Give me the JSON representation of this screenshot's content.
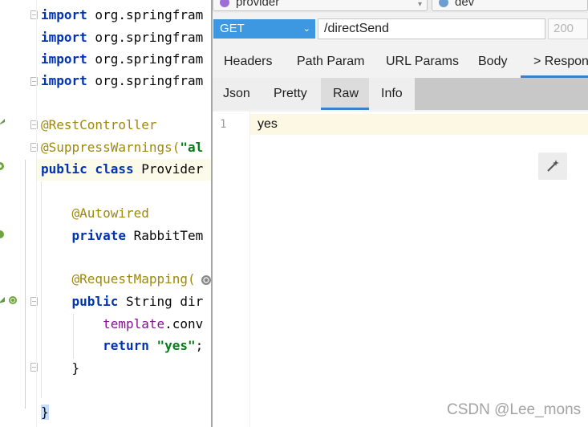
{
  "editor": {
    "lines": [
      {
        "parts": [
          {
            "t": "import",
            "c": "kw"
          },
          {
            "t": " org.springfram",
            "c": ""
          }
        ]
      },
      {
        "parts": [
          {
            "t": "import",
            "c": "kw"
          },
          {
            "t": " org.springfram",
            "c": ""
          }
        ]
      },
      {
        "parts": [
          {
            "t": "import",
            "c": "kw"
          },
          {
            "t": " org.springfram",
            "c": ""
          }
        ]
      },
      {
        "parts": [
          {
            "t": "import",
            "c": "kw"
          },
          {
            "t": " org.springfram",
            "c": ""
          }
        ]
      },
      {
        "parts": []
      },
      {
        "parts": [
          {
            "t": "@RestController",
            "c": "ann"
          }
        ]
      },
      {
        "parts": [
          {
            "t": "@SuppressWarnings(",
            "c": "ann"
          },
          {
            "t": "\"al",
            "c": "str"
          }
        ]
      },
      {
        "parts": [
          {
            "t": "public class",
            "c": "kw"
          },
          {
            "t": " Provider",
            "c": ""
          }
        ]
      },
      {
        "parts": []
      },
      {
        "parts": [
          {
            "t": "    @Autowired",
            "c": "ann"
          }
        ]
      },
      {
        "parts": [
          {
            "t": "    private",
            "c": "kw"
          },
          {
            "t": " RabbitTem",
            "c": ""
          }
        ]
      },
      {
        "parts": []
      },
      {
        "parts": [
          {
            "t": "    @RequestMapping(",
            "c": "ann"
          }
        ]
      },
      {
        "parts": [
          {
            "t": "    public",
            "c": "kw"
          },
          {
            "t": " String dir",
            "c": ""
          }
        ]
      },
      {
        "parts": [
          {
            "t": "        template",
            "c": "fld"
          },
          {
            "t": ".conv",
            "c": ""
          }
        ]
      },
      {
        "parts": [
          {
            "t": "        return ",
            "c": "kw"
          },
          {
            "t": "\"yes\"",
            "c": "str"
          },
          {
            "t": ";",
            "c": ""
          }
        ]
      },
      {
        "parts": [
          {
            "t": "    }",
            "c": ""
          }
        ]
      },
      {
        "parts": []
      },
      {
        "parts": [
          {
            "t": "}",
            "c": "brace"
          }
        ]
      }
    ]
  },
  "rest_client": {
    "service_pill": "provider",
    "env_pill": "dev",
    "method": "GET",
    "url": "/directSend",
    "status_code": "200",
    "tabs": [
      "Headers",
      "Path Param",
      "URL Params",
      "Body",
      "> Respon"
    ],
    "active_tab": "> Respon",
    "subtabs": [
      "Json",
      "Pretty",
      "Raw",
      "Info"
    ],
    "active_subtab": "Raw",
    "response": {
      "line_number": "1",
      "text": "yes"
    }
  },
  "watermark": "CSDN @Lee_mons",
  "colors": {
    "method_bg": "#3d97e1",
    "tab_accent": "#3d80c6",
    "keyword": "#0033b3",
    "annotation": "#9e880d",
    "string": "#067d17"
  }
}
